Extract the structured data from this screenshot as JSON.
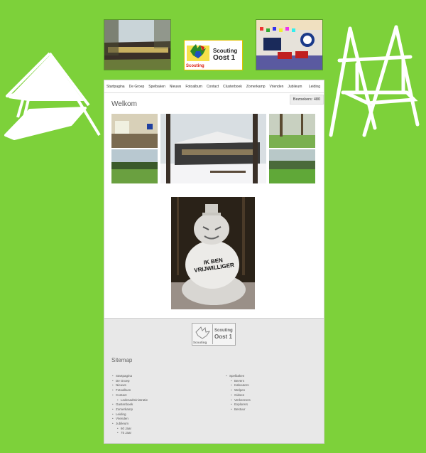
{
  "header": {
    "logo_line1": "Scouting",
    "logo_line2": "Oost 1",
    "logo_sub": "Scouting"
  },
  "nav": {
    "items": [
      "Startpagina",
      "De Groep",
      "Spelbaken",
      "Nieuws",
      "Fotoalbum",
      "Contact",
      "Clusterboek",
      "Zomerkamp",
      "Vrienden",
      "Jubileum"
    ],
    "right": "Leiding"
  },
  "visitors": "Bezoekers: 480",
  "page_title": "Welkom",
  "snowman_shirt": "IK BEN VRIJWILLIGER",
  "footer": {
    "logo_line1": "Scouting",
    "logo_line2": "Oost 1",
    "logo_sub": "Scouting"
  },
  "sitemap": {
    "title": "Sitemap",
    "left": [
      {
        "label": "Startpagina",
        "sub": false
      },
      {
        "label": "De Groep",
        "sub": false
      },
      {
        "label": "Nieuws",
        "sub": false
      },
      {
        "label": "Fotoalbum",
        "sub": false
      },
      {
        "label": "Contact",
        "sub": false
      },
      {
        "label": "Ledenadministratie",
        "sub": true
      },
      {
        "label": "Gastenboek",
        "sub": false
      },
      {
        "label": "Zomerkamp",
        "sub": false
      },
      {
        "label": "Leiding",
        "sub": false
      },
      {
        "label": "Vrienden",
        "sub": false
      },
      {
        "label": "Jubileum",
        "sub": false
      },
      {
        "label": "60 Jaar",
        "sub": true
      },
      {
        "label": "75 Jaar",
        "sub": true
      }
    ],
    "right": [
      {
        "label": "Spelbaken",
        "sub": false
      },
      {
        "label": "Bevers",
        "sub": true
      },
      {
        "label": "Kabouters",
        "sub": true
      },
      {
        "label": "Welpen",
        "sub": true
      },
      {
        "label": "Gidsen",
        "sub": true
      },
      {
        "label": "Verkenners",
        "sub": true
      },
      {
        "label": "Explorers",
        "sub": true
      },
      {
        "label": "Bestuur",
        "sub": true
      }
    ]
  },
  "colors": {
    "background": "#7dd13a",
    "page": "#ffffff",
    "footer": "#e8e8e8"
  }
}
